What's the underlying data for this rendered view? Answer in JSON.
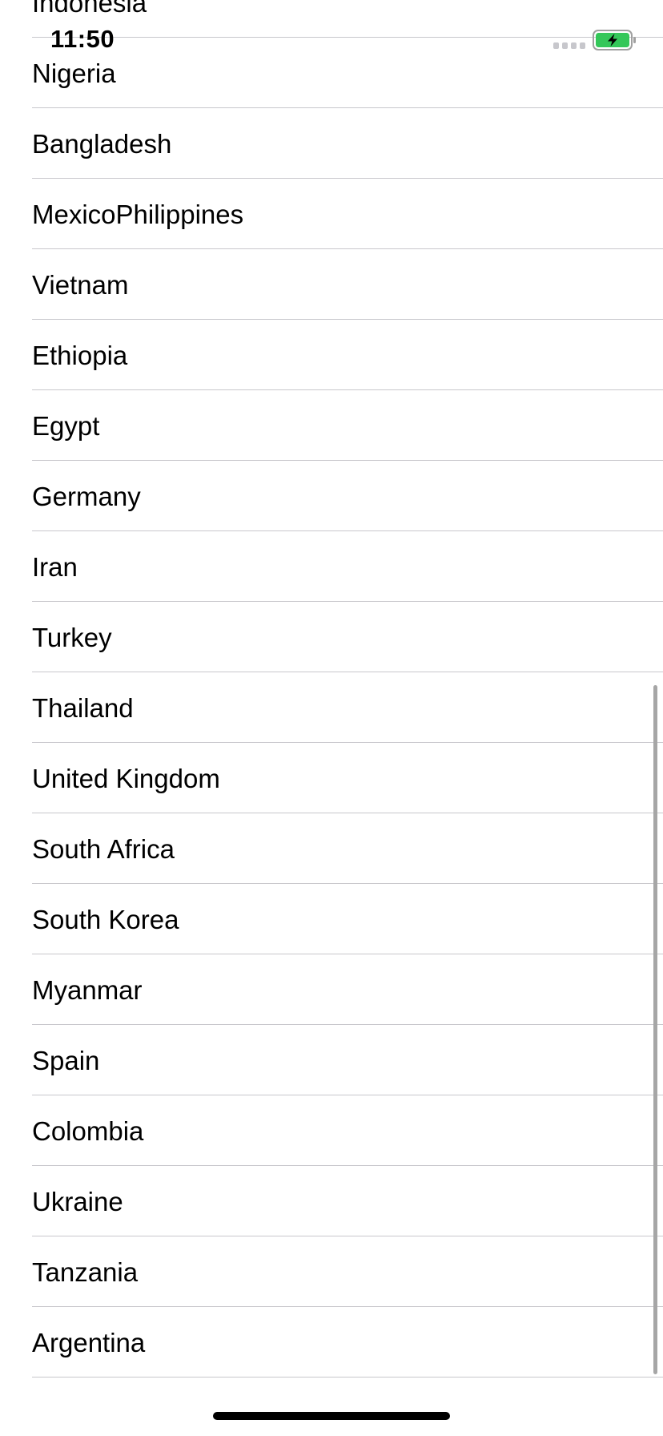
{
  "status_bar": {
    "time": "11:50"
  },
  "countries": [
    "Indonesia",
    "Nigeria",
    "Bangladesh",
    "MexicoPhilippines",
    "Vietnam",
    "Ethiopia",
    "Egypt",
    "Germany",
    "Iran",
    "Turkey",
    "Thailand",
    "United Kingdom",
    "South Africa",
    "South Korea",
    "Myanmar",
    "Spain",
    "Colombia",
    "Ukraine",
    "Tanzania",
    "Argentina"
  ],
  "colors": {
    "separator": "#c8c7cc",
    "battery_fill": "#34c759",
    "scroll_indicator": "#a6a6a6",
    "signal_dots": "#c7c7cc"
  },
  "icons": {
    "signal": "signal-dots-icon",
    "battery": "battery-charging-icon"
  }
}
